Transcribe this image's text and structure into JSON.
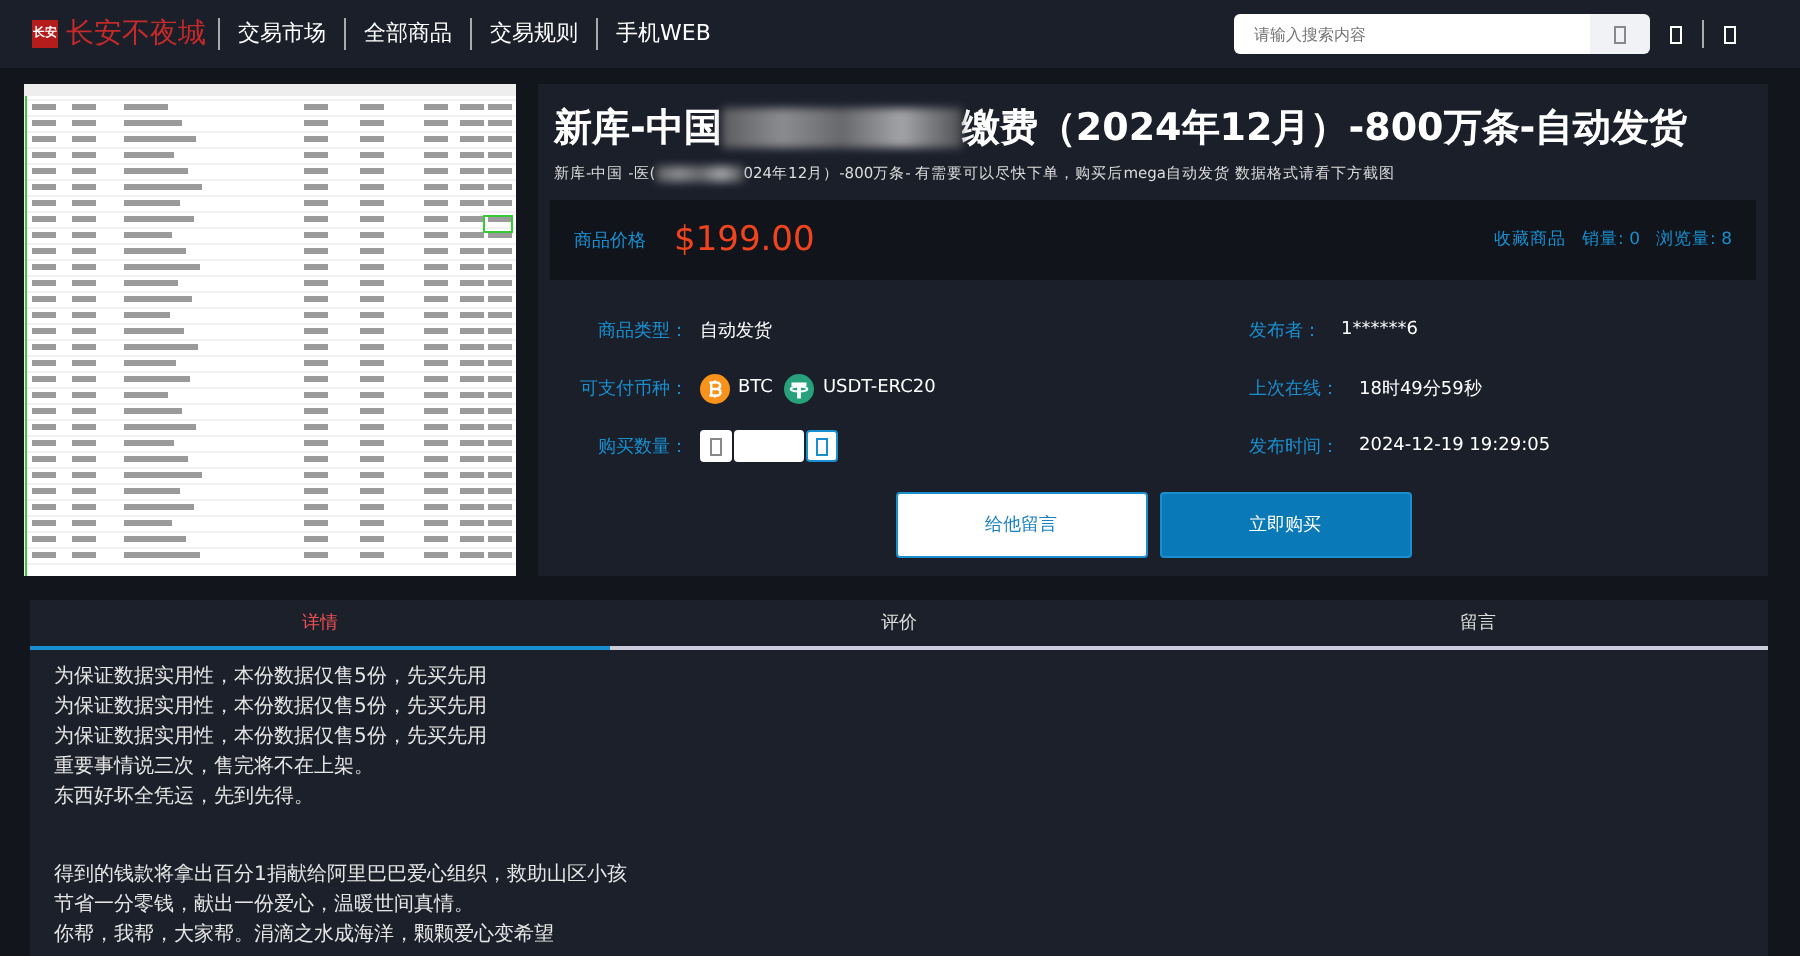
{
  "header": {
    "logo": "长安不夜城",
    "logo_mark": "长安",
    "nav": [
      {
        "label": "交易市场"
      },
      {
        "label": "全部商品"
      },
      {
        "label": "交易规则"
      },
      {
        "label": "手机WEB"
      }
    ],
    "search": {
      "placeholder": "请输入搜索内容"
    }
  },
  "product": {
    "title_start": "新库-中国",
    "title_end": "缴费（2024年12月）-800万条-自动发货",
    "subtitle_start": "新库-中国 -医(",
    "subtitle_end": "024年12月）-800万条- 有需要可以尽快下单，购买后mega自动发货 数据格式请看下方截图",
    "price_label": "商品价格",
    "price": "$199.00",
    "favorite": "收藏商品",
    "sales": "销量: 0",
    "views": "浏览量: 8",
    "fields": [
      {
        "label": "商品类型：",
        "value": "自动发货"
      },
      {
        "label": "发布者：",
        "value": "1******6"
      },
      {
        "label": "可支付币种：",
        "kind": "coins",
        "coins": [
          {
            "kind": "btc",
            "label": "BTC"
          },
          {
            "kind": "usdt",
            "label": "USDT-ERC20"
          }
        ]
      },
      {
        "label": "上次在线：",
        "value": "18时49分59秒"
      },
      {
        "label": "购买数量：",
        "kind": "quantity"
      },
      {
        "label": "发布时间：",
        "value": "2024-12-19 19:29:05"
      }
    ],
    "buttons": [
      {
        "label": "给他留言",
        "kind": "secondary"
      },
      {
        "label": "立即购买",
        "kind": "primary"
      }
    ]
  },
  "tabs": [
    {
      "label": "详情",
      "selected": true
    },
    {
      "label": "评价",
      "selected": false
    },
    {
      "label": "留言",
      "selected": false
    }
  ],
  "details": [
    [
      "为保证数据实用性，本份数据仅售5份，先买先用",
      "为保证数据实用性，本份数据仅售5份，先买先用",
      "为保证数据实用性，本份数据仅售5份，先买先用",
      "重要事情说三次，售完将不在上架。",
      "东西好坏全凭运，先到先得。"
    ],
    [
      "得到的钱款将拿出百分1捐献给阿里巴巴爱心组织，救助山区小孩",
      "节省一分零钱，献出一份爱心，温暖世间真情。",
      "你帮，我帮，大家帮。涓滴之水成海洋，颗颗爱心变希望"
    ]
  ]
}
